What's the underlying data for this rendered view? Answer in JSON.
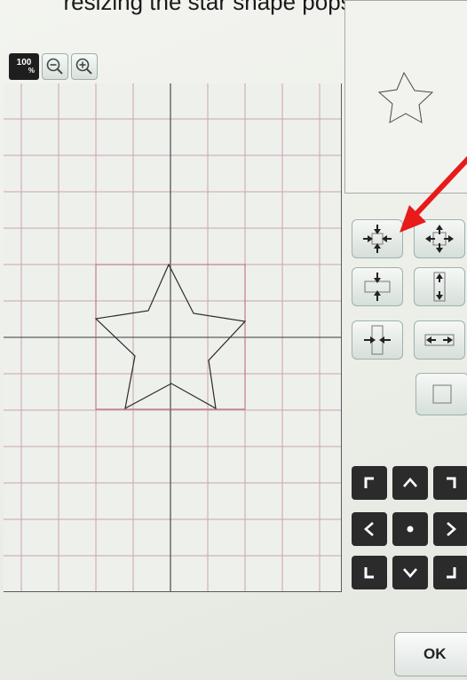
{
  "caption": "resizing the star shape pops up...",
  "zoom": {
    "level": "100",
    "unit": "%"
  },
  "ok_label": "OK",
  "colors": {
    "accent_arrow": "#e81a1a",
    "grid_line": "#c4a0a8",
    "axis_line": "#3a3a3a"
  },
  "icons": {
    "zoom_out": "magnifier-minus-icon",
    "zoom_in": "magnifier-plus-icon",
    "scale_proportional_smaller": "arrows-inward-icon",
    "scale_proportional_larger": "arrows-outward-icon",
    "scale_vertical_smaller": "arrows-vertical-inward-icon",
    "scale_vertical_larger": "arrows-vertical-outward-icon",
    "scale_horizontal_smaller": "arrows-horizontal-inward-icon",
    "scale_horizontal_larger": "arrows-horizontal-outward-icon",
    "reset": "square-icon"
  }
}
